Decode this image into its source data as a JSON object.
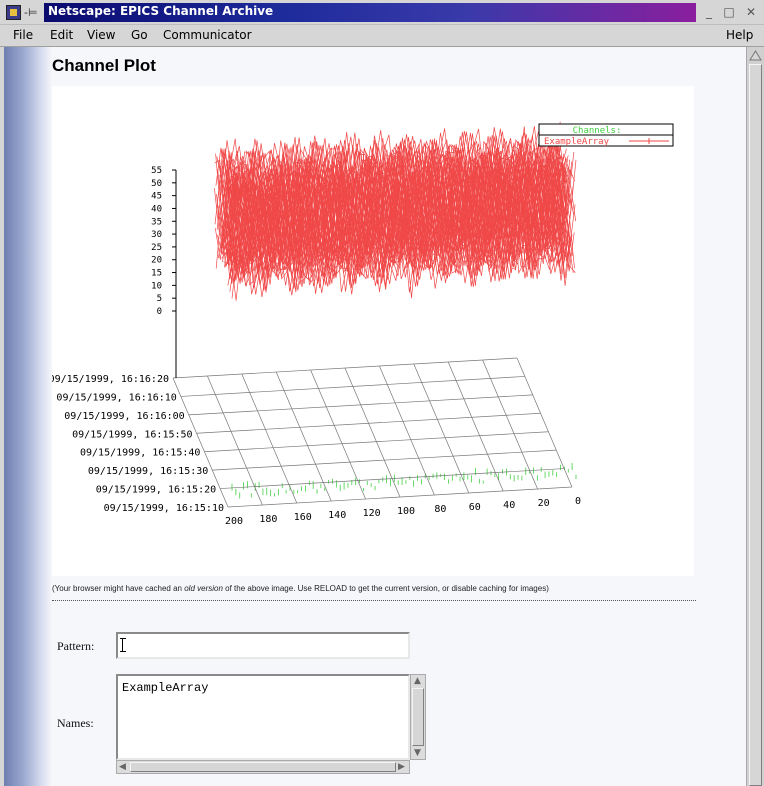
{
  "window": {
    "title": "Netscape: EPICS Channel Archive",
    "controls": {
      "pin": "-⊨",
      "minimize": "□",
      "maximize": "□",
      "close": "✕"
    }
  },
  "menu": {
    "file": "File",
    "edit": "Edit",
    "view": "View",
    "go": "Go",
    "communicator": "Communicator",
    "help": "Help"
  },
  "page": {
    "heading": "Channel Plot",
    "note_prefix": "(Your browser might have cached an ",
    "note_emph": "old version",
    "note_suffix": " of the above image. Use RELOAD to get the current version, or disable caching for images)",
    "pattern_label": "Pattern:",
    "pattern_value": "",
    "names_label": "Names:",
    "names_value": "ExampleArray"
  },
  "chart_data": {
    "type": "line",
    "title": "",
    "legend": {
      "title": "Channels:",
      "entries": [
        "ExampleArray"
      ],
      "placement": "top-right"
    },
    "colors": {
      "series": "#f04848",
      "baseline": "#40d040",
      "legend_title": "#40d040",
      "axes": "#000000"
    },
    "y_ticks": [
      "0",
      "5",
      "10",
      "15",
      "20",
      "25",
      "30",
      "35",
      "40",
      "45",
      "50",
      "55"
    ],
    "ylim": [
      0,
      55
    ],
    "x_ticks": [
      "0",
      "20",
      "40",
      "60",
      "80",
      "100",
      "120",
      "140",
      "160",
      "180",
      "200"
    ],
    "xlim": [
      0,
      200
    ],
    "time_ticks": [
      "09/15/1999, 16:15:10",
      "09/15/1999, 16:15:20",
      "09/15/1999, 16:15:30",
      "09/15/1999, 16:15:40",
      "09/15/1999, 16:15:50",
      "09/15/1999, 16:16:00",
      "09/15/1999, 16:16:10",
      "09/15/1999, 16:16:20"
    ],
    "series": [
      {
        "name": "ExampleArray",
        "value_range": [
          0,
          55
        ],
        "kind": "3d-array-waveform"
      }
    ]
  }
}
